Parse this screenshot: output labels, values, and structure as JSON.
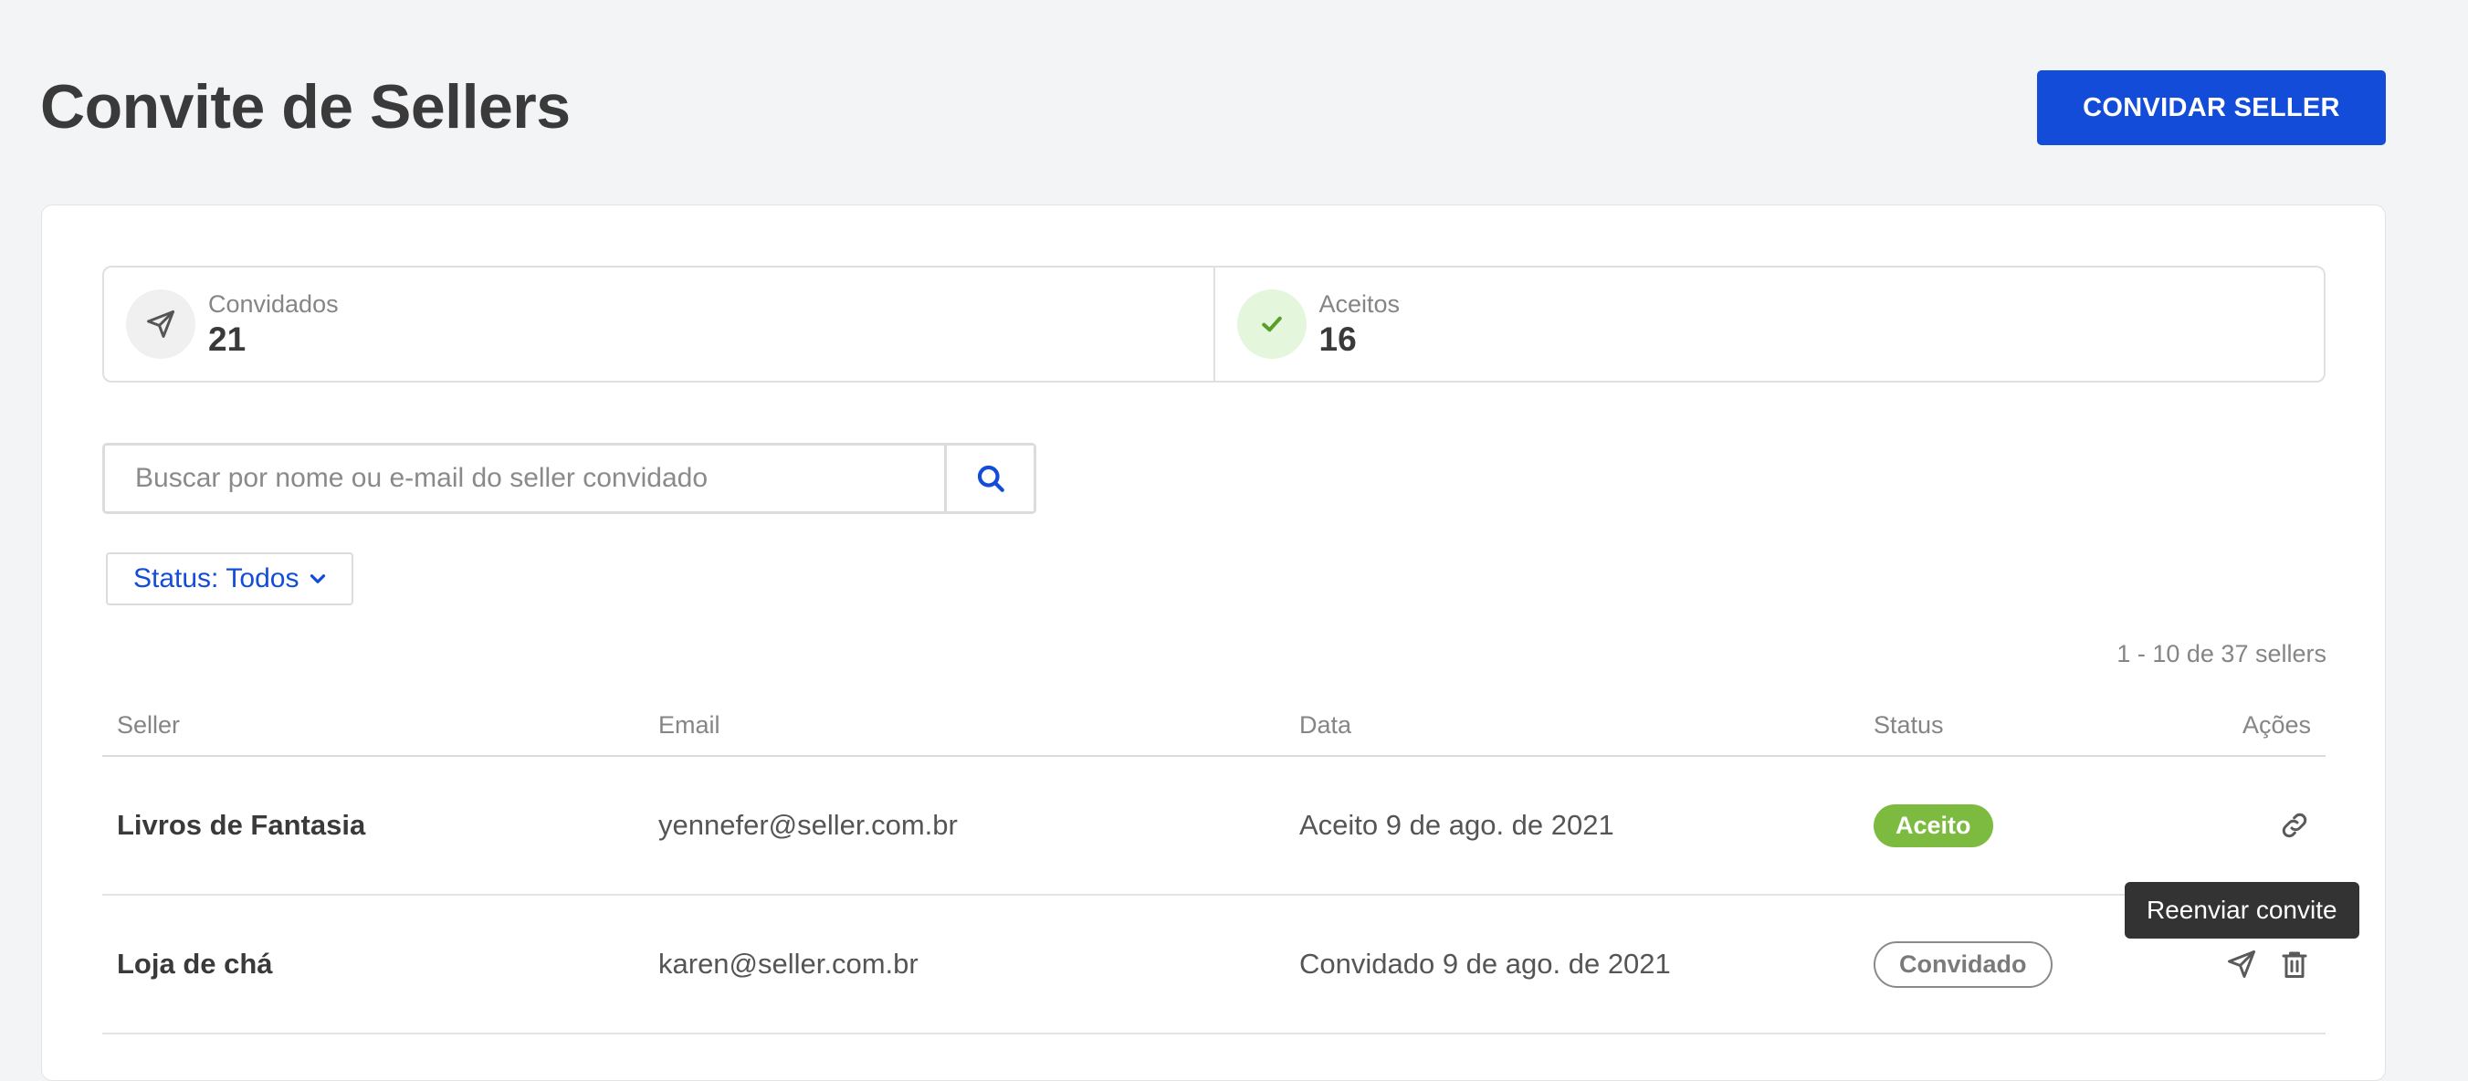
{
  "header": {
    "title": "Convite de Sellers",
    "invite_button": "CONVIDAR SELLER"
  },
  "stats": [
    {
      "label": "Convidados",
      "value": "21",
      "icon": "paper-plane-icon"
    },
    {
      "label": "Aceitos",
      "value": "16",
      "icon": "check-icon"
    }
  ],
  "search": {
    "placeholder": "Buscar por nome ou e-mail do seller convidado",
    "value": ""
  },
  "filter": {
    "label": "Status:",
    "value": "Todos"
  },
  "pagination": {
    "info": "1 - 10 de 37 sellers"
  },
  "table": {
    "columns": [
      "Seller",
      "Email",
      "Data",
      "Status",
      "Ações"
    ],
    "rows": [
      {
        "seller": "Livros de Fantasia",
        "email": "yennefer@seller.com.br",
        "date": "Aceito 9 de ago. de 2021",
        "status": "Aceito",
        "actions": [
          "link-icon"
        ]
      },
      {
        "seller": "Loja de chá",
        "email": "karen@seller.com.br",
        "date": "Convidado 9 de ago. de 2021",
        "status": "Convidado",
        "actions": [
          "paper-plane-icon",
          "trash-icon"
        ]
      }
    ]
  },
  "tooltip": {
    "text": "Reenviar convite"
  },
  "colors": {
    "primary": "#134cd8",
    "accepted": "#7cbb3f",
    "background": "#f3f4f6",
    "tooltip": "#333333"
  }
}
